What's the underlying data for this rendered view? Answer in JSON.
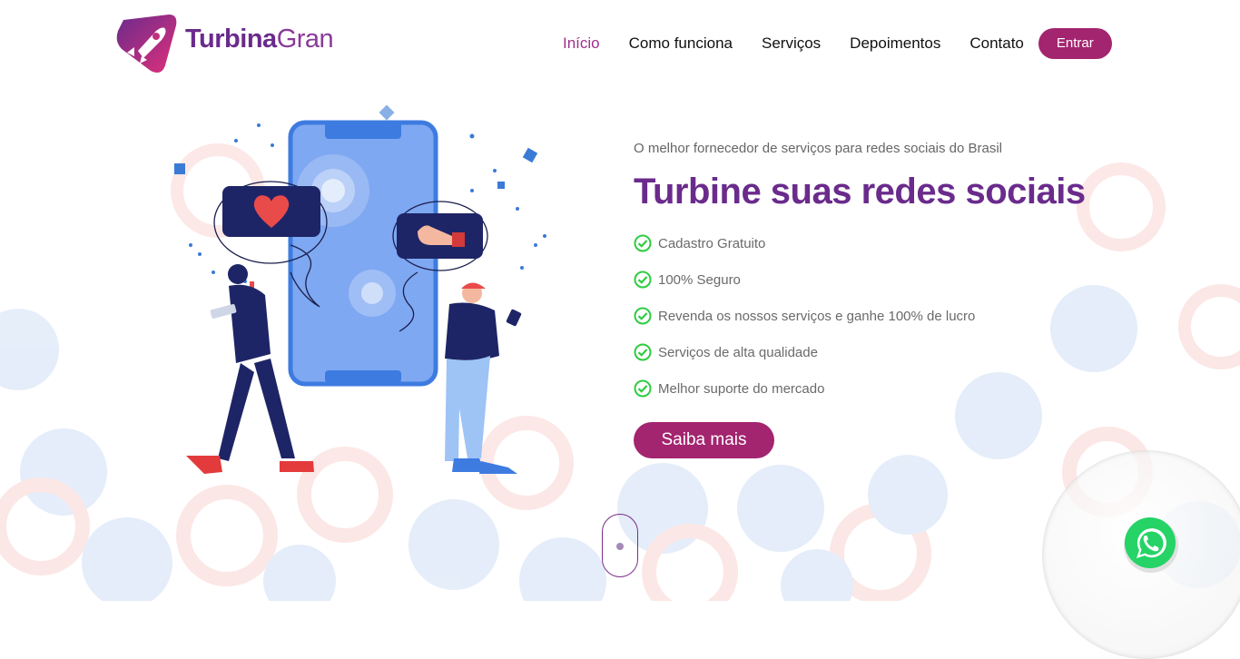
{
  "brand": {
    "name_bold": "Turbina",
    "name_light": "Gran",
    "logo_icon": "rocket-icon"
  },
  "nav": {
    "items": [
      {
        "label": "Início",
        "active": true
      },
      {
        "label": "Como funciona"
      },
      {
        "label": "Serviços"
      },
      {
        "label": "Depoimentos"
      },
      {
        "label": "Contato"
      }
    ],
    "login_label": "Entrar"
  },
  "hero": {
    "tagline": "O melhor fornecedor de serviços para redes sociais do Brasil",
    "headline": "Turbine suas redes sociais",
    "features": [
      "Cadastro Gratuito",
      "100% Seguro",
      "Revenda os nossos serviços e ganhe 100% de lucro",
      "Serviços de alta qualidade",
      "Melhor suporte do mercado"
    ],
    "cta_label": "Saiba mais"
  },
  "colors": {
    "primary": "#6a2b8c",
    "accent": "#a3246f",
    "check": "#2ecc40",
    "whatsapp": "#25d366"
  },
  "widgets": {
    "whatsapp_icon": "whatsapp-icon",
    "scroll_icon": "mouse-scroll-icon"
  }
}
